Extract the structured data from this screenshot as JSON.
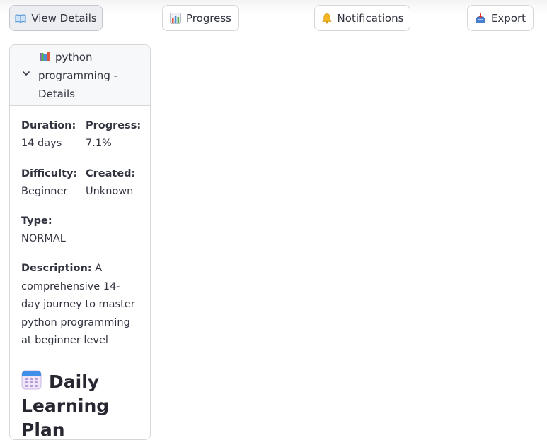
{
  "toolbar": {
    "view_details": {
      "label": "View Details",
      "icon": "open-book-icon"
    },
    "progress": {
      "label": "Progress",
      "icon": "bar-chart-icon"
    },
    "notifications": {
      "label": "Notifications",
      "icon": "bell-icon"
    },
    "export": {
      "label": "Export",
      "icon": "inbox-tray-icon"
    }
  },
  "details": {
    "header_title": "python programming - Details",
    "header_icon": "books-icon",
    "expanded": true,
    "duration": {
      "label": "Duration:",
      "value": "14 days"
    },
    "progress": {
      "label": "Progress:",
      "value": "7.1%"
    },
    "difficulty": {
      "label": "Difficulty:",
      "value": "Beginner"
    },
    "created": {
      "label": "Created:",
      "value": "Unknown"
    },
    "type": {
      "label": "Type:",
      "value": "NORMAL"
    },
    "description": {
      "label": "Description:",
      "value": "A comprehensive 14-day journey to master python programming at beginner level"
    },
    "section_title": "Daily Learning Plan",
    "section_icon": "calendar-icon"
  },
  "colors": {
    "text": "#31333f",
    "border": "#d6d6d9",
    "active_button_bg": "#eceef2",
    "header_bg": "#f7f8fa"
  }
}
